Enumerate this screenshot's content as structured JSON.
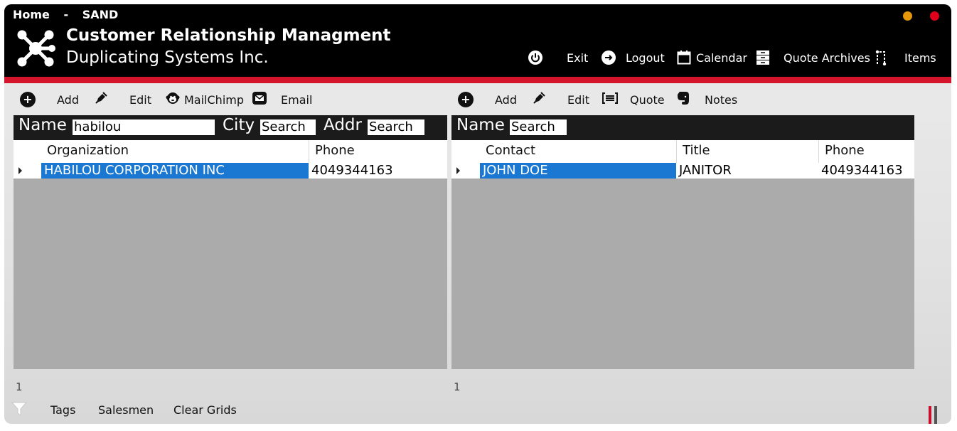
{
  "breadcrumb": {
    "home": "Home",
    "sep": "-",
    "env": "SAND"
  },
  "window_controls": {
    "minimize_color": "#e5960a",
    "close_color": "#e0001b"
  },
  "app": {
    "title": "Customer Relationship Managment",
    "company": "Duplicating Systems Inc."
  },
  "nav": {
    "exit": "Exit",
    "logout": "Logout",
    "calendar": "Calendar",
    "quote_archives": "Quote Archives",
    "items": "Items"
  },
  "org_toolbar": {
    "add": "Add",
    "edit": "Edit",
    "mailchimp": "MailChimp",
    "email": "Email"
  },
  "contact_toolbar": {
    "add": "Add",
    "edit": "Edit",
    "quote": "Quote",
    "notes": "Notes"
  },
  "org_search": {
    "name_label": "Name",
    "name_value": "habilou",
    "city_label": "City",
    "city_value": "Search",
    "addr_label": "Addr",
    "addr_value": "Search"
  },
  "contact_search": {
    "name_label": "Name",
    "name_value": "Search"
  },
  "org_grid": {
    "columns": [
      "Organization",
      "Phone"
    ],
    "rows": [
      {
        "organization": "HABILOU CORPORATION INC",
        "phone": "4049344163"
      }
    ],
    "count": "1"
  },
  "contact_grid": {
    "columns": [
      "Contact",
      "Title",
      "Phone"
    ],
    "rows": [
      {
        "contact": "JOHN DOE",
        "title": "JANITOR",
        "phone": "4049344163"
      }
    ],
    "count": "1"
  },
  "bottom": {
    "tags": "Tags",
    "salesmen": "Salesmen",
    "clear_grids": "Clear Grids"
  },
  "colors": {
    "accent_red": "#d4152c",
    "selection_blue": "#1a78d2"
  }
}
